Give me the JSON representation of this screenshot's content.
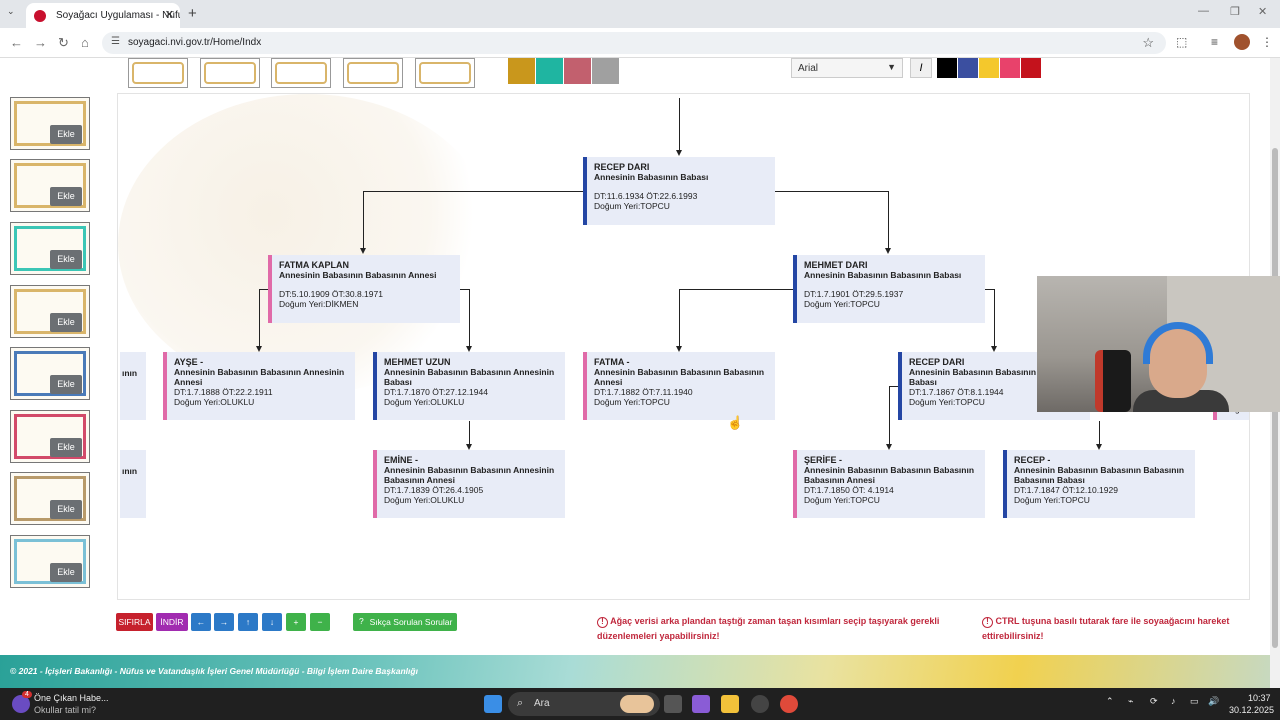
{
  "browser": {
    "tab_title": "Soyağacı Uygulaması - Nüfus ve",
    "tab_close": "✕",
    "new_tab": "+",
    "url": "soyagaci.nvi.gov.tr/Home/Indx"
  },
  "toolbar": {
    "font_select": "Arial",
    "italic_label": "I",
    "bg_colors": [
      "#c9971c",
      "#1fb5a1",
      "#c2606e",
      "#a0a0a0"
    ],
    "font_colors": [
      "#000000",
      "#3b4fa0",
      "#f4c82c",
      "#e8426b",
      "#c4121c"
    ]
  },
  "sidebar": {
    "cards": [
      {
        "ekle": "Ekle"
      },
      {
        "ekle": "Ekle"
      },
      {
        "ekle": "Ekle"
      },
      {
        "ekle": "Ekle"
      },
      {
        "ekle": "Ekle"
      },
      {
        "ekle": "Ekle"
      },
      {
        "ekle": "Ekle"
      },
      {
        "ekle": "Ekle"
      }
    ]
  },
  "tree": {
    "root": {
      "name": "RECEP DARI",
      "rel": "Annesinin Babasının Babası",
      "dates": "DT:11.6.1934 ÖT:22.6.1993",
      "place": "Doğum Yeri:TOPCU"
    },
    "fatma_kaplan": {
      "name": "FATMA KAPLAN",
      "rel": "Annesinin Babasının Babasının Annesi",
      "dates": "DT:5.10.1909 ÖT:30.8.1971",
      "place": "Doğum Yeri:DİKMEN"
    },
    "mehmet_dari": {
      "name": "MEHMET DARI",
      "rel": "Annesinin Babasının Babasının Babası",
      "dates": "DT:1.7.1901 ÖT:29.5.1937",
      "place": "Doğum Yeri:TOPCU"
    },
    "left_partial": {
      "name": "ının"
    },
    "ayse": {
      "name": "AYŞE -",
      "rel": "Annesinin Babasının Babasının Annesinin Annesi",
      "dates": "DT:1.7.1888 ÖT:22.2.1911",
      "place": "Doğum Yeri:OLUKLU"
    },
    "mehmet_uzun": {
      "name": "MEHMET UZUN",
      "rel": "Annesinin Babasının Babasının Annesinin Babası",
      "dates": "DT:1.7.1870 ÖT:27.12.1944",
      "place": "Doğum Yeri:OLUKLU"
    },
    "fatma": {
      "name": "FATMA -",
      "rel": "Annesinin Babasının Babasının Babasının Annesi",
      "dates": "DT:1.7.1882 ÖT:7.11.1940",
      "place": "Doğum Yeri:TOPCU"
    },
    "recep_dari2": {
      "name": "RECEP DARI",
      "rel": "Annesinin Babasının Babasının Babasının Babası",
      "dates": "DT:1.7.1867 ÖT:8.1.1944",
      "place": "Doğum Yeri:TOPCU"
    },
    "right_partial": {
      "place": "Doğu"
    },
    "left_partial2": {
      "name": "ının"
    },
    "emine": {
      "name": "EMİNE -",
      "rel": "Annesinin Babasının Babasının Annesinin Babasının Annesi",
      "dates": "DT:1.7.1839 ÖT:26.4.1905",
      "place": "Doğum Yeri:OLUKLU"
    },
    "serife": {
      "name": "ŞERİFE -",
      "rel": "Annesinin Babasının Babasının Babasının Babasının Annesi",
      "dates": "DT:1.7.1850 ÖT: 4.1914",
      "place": "Doğum Yeri:TOPCU"
    },
    "recep": {
      "name": "RECEP -",
      "rel": "Annesinin Babasının Babasının Babasının Babasının Babası",
      "dates": "DT:1.7.1847 ÖT:12.10.1929",
      "place": "Doğum Yeri:TOPCU"
    }
  },
  "actions": {
    "sifirla": "SIFIRLA",
    "indir": "İNDİR",
    "left": "←",
    "right": "→",
    "up": "↑",
    "down": "↓",
    "plus": "+",
    "minus": "−",
    "faq": "Sıkça Sorulan Sorular"
  },
  "notes": {
    "note1": "Ağaç verisi arka plandan taştığı zaman taşan kısımları seçip taşıyarak gerekli düzenlemeleri yapabilirsiniz!",
    "note2": "CTRL tuşuna basılı tutarak fare ile soyaağacını hareket ettirebilirsiniz!"
  },
  "footer": {
    "text": "© 2021 - İçişleri Bakanlığı - Nüfus ve Vatandaşlık İşleri Genel Müdürlüğü - Bilgi İşlem Daire Başkanlığı"
  },
  "taskbar": {
    "news_title": "Öne Çıkan Habe...",
    "news_sub": "Okullar tatil mi?",
    "news_badge": "4",
    "search": "Ara",
    "time": "10:37",
    "date": "30.12.2025"
  }
}
